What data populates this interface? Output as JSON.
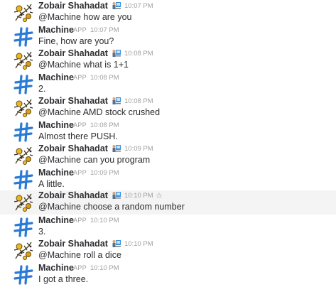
{
  "icons": {
    "user_avatar": "circuit-flower-avatar-icon",
    "bot_avatar": "machine-bot-avatar-icon",
    "flair": "person-at-computer-icon",
    "star": "star-outline-icon"
  },
  "colors": {
    "bot_blue": "#2a7ad8",
    "muted": "#a0a0a2",
    "highlight": "#f4f4f4"
  },
  "messages": [
    {
      "sender": "Zobair Shahadat",
      "app": "",
      "time": "10:07 PM",
      "text": "@Machine how are you"
    },
    {
      "sender": "Machine",
      "app": "APP",
      "time": "10:07 PM",
      "text": "Fine, how are you?"
    },
    {
      "sender": "Zobair Shahadat",
      "app": "",
      "time": "10:08 PM",
      "text": "@Machine what is 1+1"
    },
    {
      "sender": "Machine",
      "app": "APP",
      "time": "10:08 PM",
      "text": "2."
    },
    {
      "sender": "Zobair Shahadat",
      "app": "",
      "time": "10:08 PM",
      "text": "@Machine AMD stock crushed"
    },
    {
      "sender": "Machine",
      "app": "APP",
      "time": "10:08 PM",
      "text": "Almost there PUSH."
    },
    {
      "sender": "Zobair Shahadat",
      "app": "",
      "time": "10:09 PM",
      "text": "@Machine can you program"
    },
    {
      "sender": "Machine",
      "app": "APP",
      "time": "10:09 PM",
      "text": "A little."
    },
    {
      "sender": "Zobair Shahadat",
      "app": "",
      "time": "10:10 PM",
      "text": "@Machine choose a random number",
      "star": "☆"
    },
    {
      "sender": "Machine",
      "app": "APP",
      "time": "10:10 PM",
      "text": "3."
    },
    {
      "sender": "Zobair Shahadat",
      "app": "",
      "time": "10:10 PM",
      "text": "@Machine roll a dice"
    },
    {
      "sender": "Machine",
      "app": "APP",
      "time": "10:10 PM",
      "text": "I got a three."
    }
  ]
}
